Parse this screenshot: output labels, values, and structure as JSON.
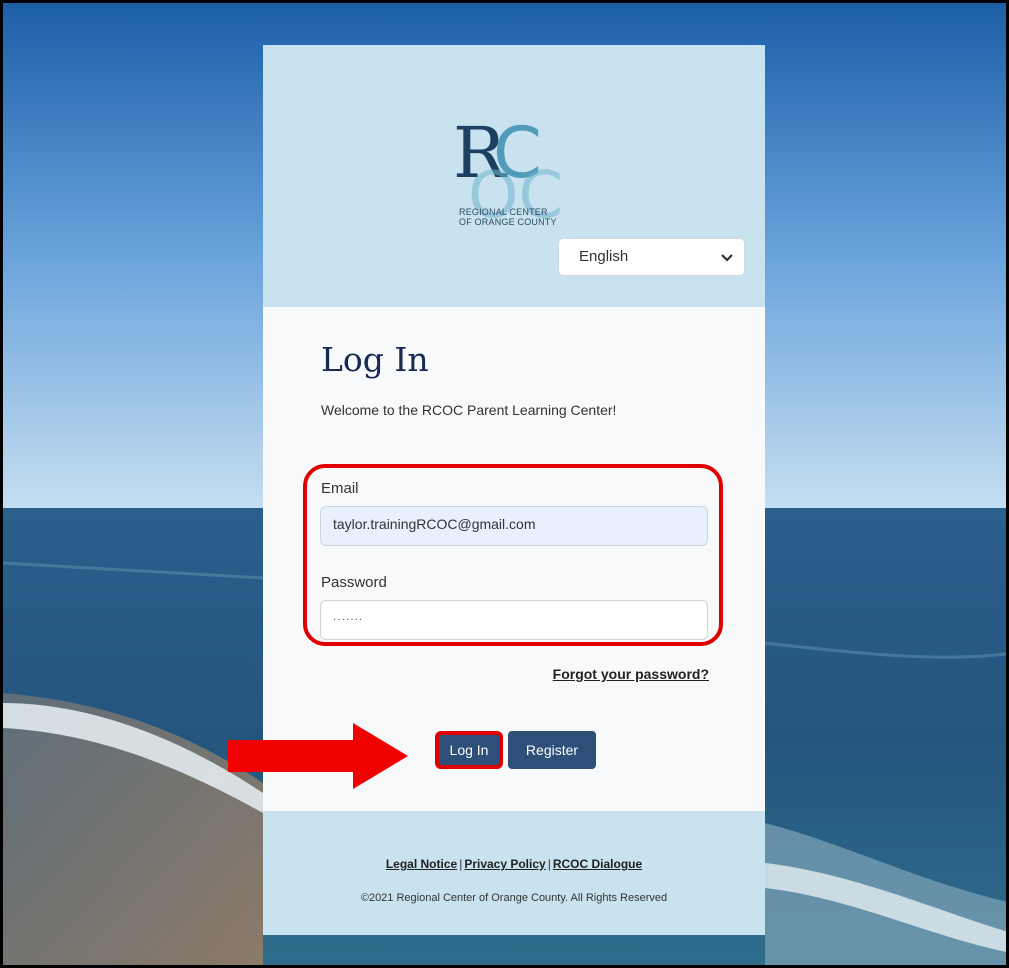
{
  "logo": {
    "caption_line1": "REGIONAL CENTER",
    "caption_line2": "OF ORANGE COUNTY"
  },
  "language_select": {
    "value": "English",
    "icon": "chevron-down-icon"
  },
  "login": {
    "title": "Log In",
    "welcome": "Welcome to the RCOC Parent Learning Center!",
    "email_label": "Email",
    "email_value": "taylor.trainingRCOC@gmail.com",
    "password_label": "Password",
    "password_value": "·······",
    "forgot_link": "Forgot your password?",
    "login_button": "Log In",
    "register_button": "Register"
  },
  "footer": {
    "links": [
      "Legal Notice",
      "Privacy Policy",
      "RCOC Dialogue"
    ],
    "separator": "|",
    "copyright": "©2021 Regional Center of Orange County. All Rights Reserved"
  },
  "colors": {
    "highlight_red": "#e00000",
    "card_blue": "#c9e2ef",
    "button_blue": "#2e4f78",
    "title_navy": "#162a52"
  }
}
